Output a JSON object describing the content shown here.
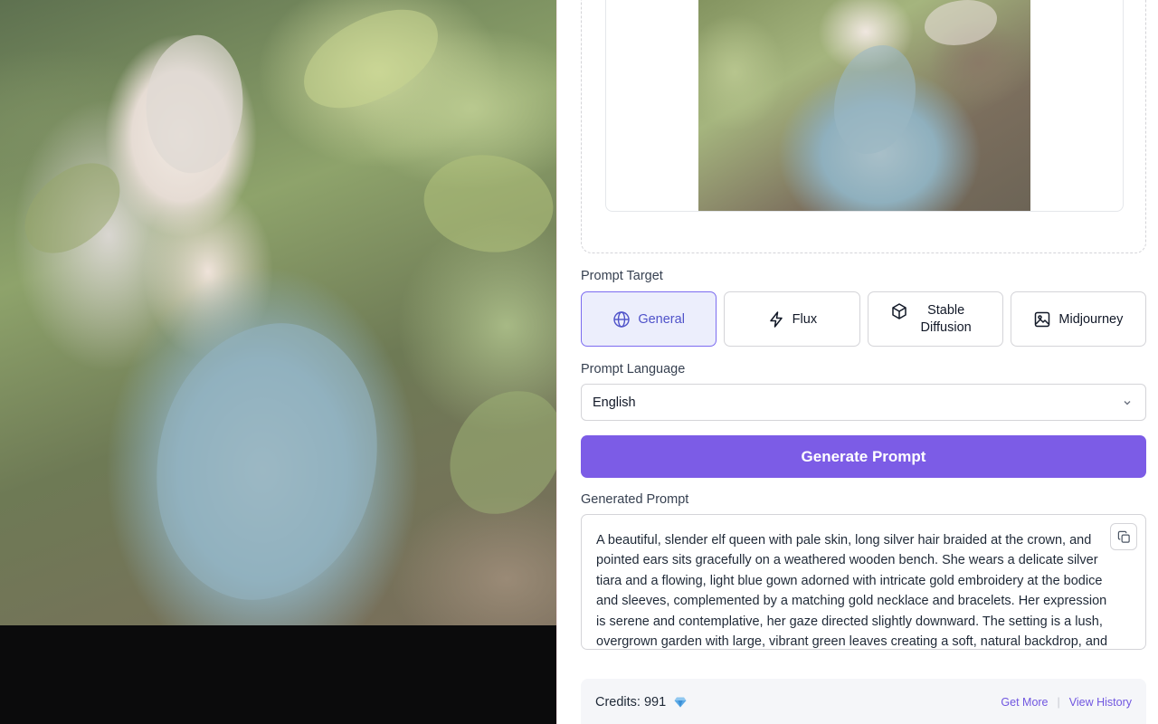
{
  "prompt_target": {
    "label": "Prompt Target",
    "options": [
      {
        "label": "General",
        "icon": "globe-icon",
        "active": true
      },
      {
        "label": "Flux",
        "icon": "lightning-icon",
        "active": false
      },
      {
        "label": "Stable Diffusion",
        "icon": "cube-icon",
        "active": false
      },
      {
        "label": "Midjourney",
        "icon": "image-icon",
        "active": false
      }
    ]
  },
  "prompt_language": {
    "label": "Prompt Language",
    "selected": "English"
  },
  "generate_button": "Generate Prompt",
  "generated_prompt": {
    "label": "Generated Prompt",
    "text": "A beautiful, slender elf queen with pale skin, long silver hair braided at the crown, and pointed ears sits gracefully on a weathered wooden bench. She wears a delicate silver tiara and a flowing, light blue gown adorned with intricate gold embroidery at the bodice and sleeves, complemented by a matching gold necklace and bracelets. Her expression is serene and contemplative, her gaze directed slightly downward. The setting is a lush, overgrown garden with large, vibrant green leaves creating a soft, natural backdrop, and a"
  },
  "credits": {
    "label": "Credits: 991",
    "get_more": "Get More",
    "separator": "|",
    "view_history": "View History"
  },
  "colors": {
    "accent": "#7c5ce6",
    "active_tab_bg": "#eceefc",
    "active_tab_text": "#4f52c9",
    "link": "#7056e0"
  }
}
